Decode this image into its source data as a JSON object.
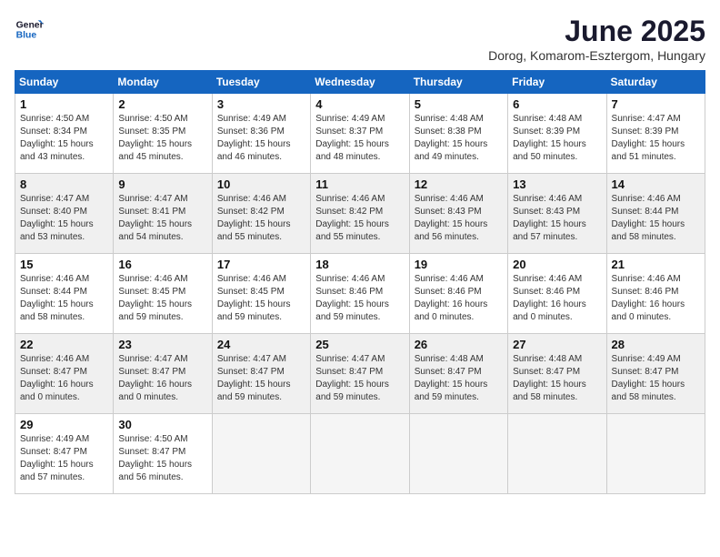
{
  "header": {
    "logo_line1": "General",
    "logo_line2": "Blue",
    "title": "June 2025",
    "subtitle": "Dorog, Komarom-Esztergom, Hungary"
  },
  "days_of_week": [
    "Sunday",
    "Monday",
    "Tuesday",
    "Wednesday",
    "Thursday",
    "Friday",
    "Saturday"
  ],
  "weeks": [
    [
      {
        "day": "1",
        "lines": [
          "Sunrise: 4:50 AM",
          "Sunset: 8:34 PM",
          "Daylight: 15 hours",
          "and 43 minutes."
        ]
      },
      {
        "day": "2",
        "lines": [
          "Sunrise: 4:50 AM",
          "Sunset: 8:35 PM",
          "Daylight: 15 hours",
          "and 45 minutes."
        ]
      },
      {
        "day": "3",
        "lines": [
          "Sunrise: 4:49 AM",
          "Sunset: 8:36 PM",
          "Daylight: 15 hours",
          "and 46 minutes."
        ]
      },
      {
        "day": "4",
        "lines": [
          "Sunrise: 4:49 AM",
          "Sunset: 8:37 PM",
          "Daylight: 15 hours",
          "and 48 minutes."
        ]
      },
      {
        "day": "5",
        "lines": [
          "Sunrise: 4:48 AM",
          "Sunset: 8:38 PM",
          "Daylight: 15 hours",
          "and 49 minutes."
        ]
      },
      {
        "day": "6",
        "lines": [
          "Sunrise: 4:48 AM",
          "Sunset: 8:39 PM",
          "Daylight: 15 hours",
          "and 50 minutes."
        ]
      },
      {
        "day": "7",
        "lines": [
          "Sunrise: 4:47 AM",
          "Sunset: 8:39 PM",
          "Daylight: 15 hours",
          "and 51 minutes."
        ]
      }
    ],
    [
      {
        "day": "8",
        "lines": [
          "Sunrise: 4:47 AM",
          "Sunset: 8:40 PM",
          "Daylight: 15 hours",
          "and 53 minutes."
        ]
      },
      {
        "day": "9",
        "lines": [
          "Sunrise: 4:47 AM",
          "Sunset: 8:41 PM",
          "Daylight: 15 hours",
          "and 54 minutes."
        ]
      },
      {
        "day": "10",
        "lines": [
          "Sunrise: 4:46 AM",
          "Sunset: 8:42 PM",
          "Daylight: 15 hours",
          "and 55 minutes."
        ]
      },
      {
        "day": "11",
        "lines": [
          "Sunrise: 4:46 AM",
          "Sunset: 8:42 PM",
          "Daylight: 15 hours",
          "and 55 minutes."
        ]
      },
      {
        "day": "12",
        "lines": [
          "Sunrise: 4:46 AM",
          "Sunset: 8:43 PM",
          "Daylight: 15 hours",
          "and 56 minutes."
        ]
      },
      {
        "day": "13",
        "lines": [
          "Sunrise: 4:46 AM",
          "Sunset: 8:43 PM",
          "Daylight: 15 hours",
          "and 57 minutes."
        ]
      },
      {
        "day": "14",
        "lines": [
          "Sunrise: 4:46 AM",
          "Sunset: 8:44 PM",
          "Daylight: 15 hours",
          "and 58 minutes."
        ]
      }
    ],
    [
      {
        "day": "15",
        "lines": [
          "Sunrise: 4:46 AM",
          "Sunset: 8:44 PM",
          "Daylight: 15 hours",
          "and 58 minutes."
        ]
      },
      {
        "day": "16",
        "lines": [
          "Sunrise: 4:46 AM",
          "Sunset: 8:45 PM",
          "Daylight: 15 hours",
          "and 59 minutes."
        ]
      },
      {
        "day": "17",
        "lines": [
          "Sunrise: 4:46 AM",
          "Sunset: 8:45 PM",
          "Daylight: 15 hours",
          "and 59 minutes."
        ]
      },
      {
        "day": "18",
        "lines": [
          "Sunrise: 4:46 AM",
          "Sunset: 8:46 PM",
          "Daylight: 15 hours",
          "and 59 minutes."
        ]
      },
      {
        "day": "19",
        "lines": [
          "Sunrise: 4:46 AM",
          "Sunset: 8:46 PM",
          "Daylight: 16 hours",
          "and 0 minutes."
        ]
      },
      {
        "day": "20",
        "lines": [
          "Sunrise: 4:46 AM",
          "Sunset: 8:46 PM",
          "Daylight: 16 hours",
          "and 0 minutes."
        ]
      },
      {
        "day": "21",
        "lines": [
          "Sunrise: 4:46 AM",
          "Sunset: 8:46 PM",
          "Daylight: 16 hours",
          "and 0 minutes."
        ]
      }
    ],
    [
      {
        "day": "22",
        "lines": [
          "Sunrise: 4:46 AM",
          "Sunset: 8:47 PM",
          "Daylight: 16 hours",
          "and 0 minutes."
        ]
      },
      {
        "day": "23",
        "lines": [
          "Sunrise: 4:47 AM",
          "Sunset: 8:47 PM",
          "Daylight: 16 hours",
          "and 0 minutes."
        ]
      },
      {
        "day": "24",
        "lines": [
          "Sunrise: 4:47 AM",
          "Sunset: 8:47 PM",
          "Daylight: 15 hours",
          "and 59 minutes."
        ]
      },
      {
        "day": "25",
        "lines": [
          "Sunrise: 4:47 AM",
          "Sunset: 8:47 PM",
          "Daylight: 15 hours",
          "and 59 minutes."
        ]
      },
      {
        "day": "26",
        "lines": [
          "Sunrise: 4:48 AM",
          "Sunset: 8:47 PM",
          "Daylight: 15 hours",
          "and 59 minutes."
        ]
      },
      {
        "day": "27",
        "lines": [
          "Sunrise: 4:48 AM",
          "Sunset: 8:47 PM",
          "Daylight: 15 hours",
          "and 58 minutes."
        ]
      },
      {
        "day": "28",
        "lines": [
          "Sunrise: 4:49 AM",
          "Sunset: 8:47 PM",
          "Daylight: 15 hours",
          "and 58 minutes."
        ]
      }
    ],
    [
      {
        "day": "29",
        "lines": [
          "Sunrise: 4:49 AM",
          "Sunset: 8:47 PM",
          "Daylight: 15 hours",
          "and 57 minutes."
        ]
      },
      {
        "day": "30",
        "lines": [
          "Sunrise: 4:50 AM",
          "Sunset: 8:47 PM",
          "Daylight: 15 hours",
          "and 56 minutes."
        ]
      },
      null,
      null,
      null,
      null,
      null
    ]
  ]
}
